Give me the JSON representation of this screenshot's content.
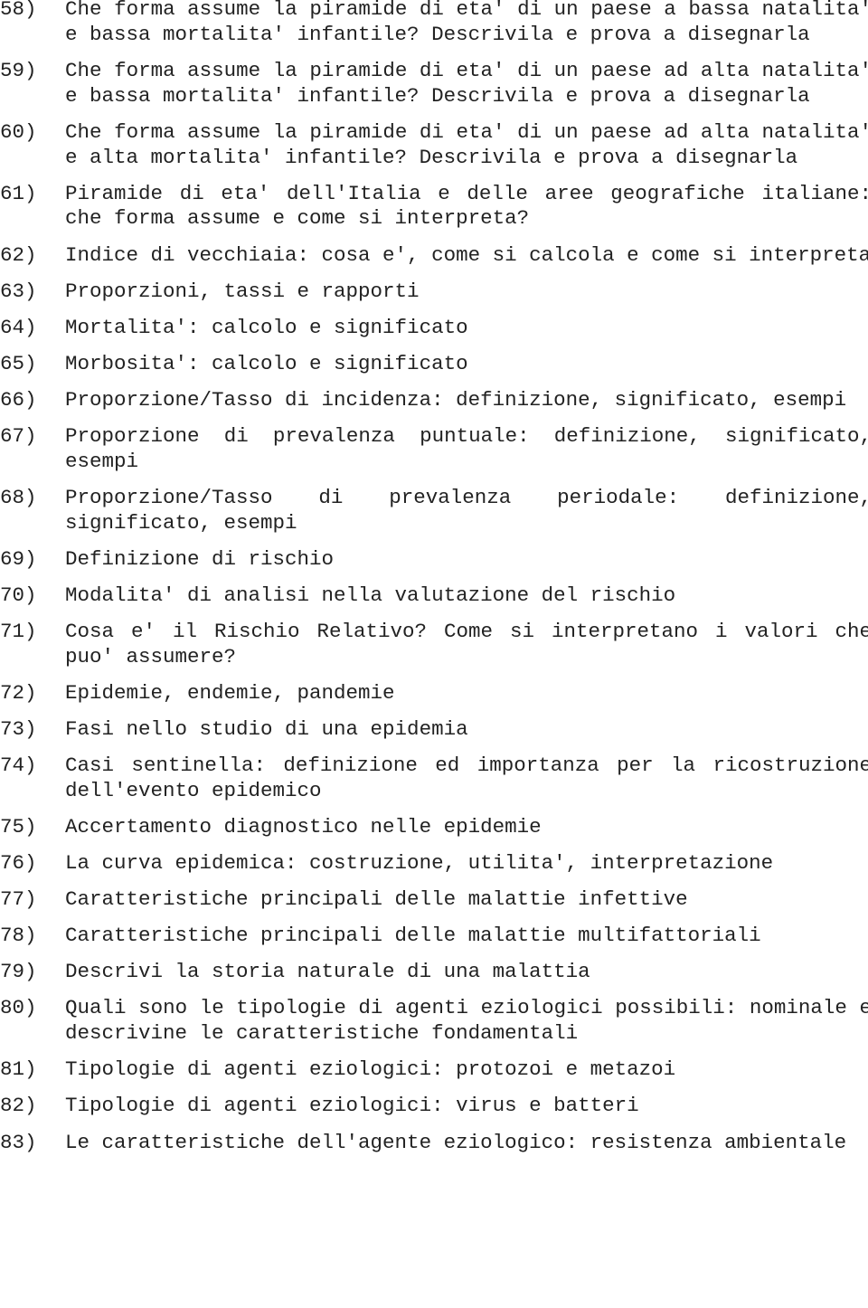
{
  "document": {
    "items": [
      {
        "number": "58)",
        "text": "Che forma assume la piramide di eta′ di un paese a bassa natalita′ e bassa mortalita′ infantile? Descrivila e prova a disegnarla"
      },
      {
        "number": "59)",
        "text": "Che forma assume la piramide di eta′ di un paese ad alta natalita′ e bassa mortalita′ infantile? Descrivila e prova a disegnarla"
      },
      {
        "number": "60)",
        "text": "Che forma assume la piramide di eta′ di un paese ad alta natalita′ e alta mortalita′ infantile? Descrivila e prova a disegnarla"
      },
      {
        "number": "61)",
        "text": "Piramide di eta′ dell'Italia e delle aree geografiche italiane: che forma assume e come si interpreta?"
      },
      {
        "number": "62)",
        "text": "Indice di vecchiaia: cosa e′, come si calcola e come si interpreta"
      },
      {
        "number": "63)",
        "text": "Proporzioni, tassi e rapporti"
      },
      {
        "number": "64)",
        "text": "Mortalita′: calcolo e significato"
      },
      {
        "number": "65)",
        "text": "Morbosita′: calcolo e significato"
      },
      {
        "number": "66)",
        "text": "Proporzione/Tasso di incidenza: definizione, significato, esempi"
      },
      {
        "number": "67)",
        "text": "Proporzione di prevalenza puntuale: definizione, significato, esempi"
      },
      {
        "number": "68)",
        "text": "Proporzione/Tasso di prevalenza periodale: definizione, significato, esempi"
      },
      {
        "number": "69)",
        "text": "Definizione di rischio"
      },
      {
        "number": "70)",
        "text": "Modalita′ di analisi nella valutazione del rischio"
      },
      {
        "number": "71)",
        "text": "Cosa e′ il Rischio Relativo? Come si interpretano i valori che puo′ assumere?"
      },
      {
        "number": "72)",
        "text": "Epidemie, endemie, pandemie"
      },
      {
        "number": "73)",
        "text": "Fasi nello studio di una epidemia"
      },
      {
        "number": "74)",
        "text": "Casi sentinella: definizione ed importanza per la ricostruzione dell'evento epidemico"
      },
      {
        "number": "75)",
        "text": "Accertamento diagnostico nelle epidemie"
      },
      {
        "number": "76)",
        "text": "La curva epidemica: costruzione, utilita′, interpretazione"
      },
      {
        "number": "77)",
        "text": "Caratteristiche principali delle malattie infettive"
      },
      {
        "number": "78)",
        "text": "Caratteristiche principali delle malattie multifattoriali"
      },
      {
        "number": "79)",
        "text": "Descrivi la storia naturale di una malattia"
      },
      {
        "number": "80)",
        "text": "Quali sono le tipologie di agenti eziologici possibili: nominale e descrivine le caratteristiche fondamentali"
      },
      {
        "number": "81)",
        "text": "Tipologie di agenti eziologici: protozoi e metazoi"
      },
      {
        "number": "82)",
        "text": "Tipologie di agenti eziologici: virus e batteri"
      },
      {
        "number": "83)",
        "text": "Le caratteristiche dell'agente eziologico: resistenza ambientale"
      }
    ]
  }
}
